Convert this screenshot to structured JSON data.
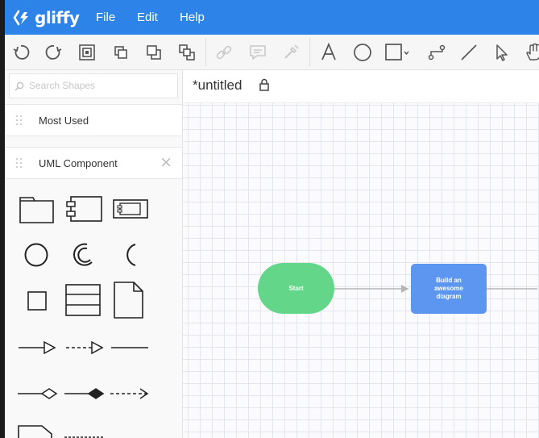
{
  "app": {
    "brand": "gliffy",
    "accent_color": "#2e83e8"
  },
  "menu": {
    "items": [
      "File",
      "Edit",
      "Help"
    ]
  },
  "toolbar": {
    "tools": [
      "undo-icon",
      "redo-icon",
      "bring-to-front-icon",
      "bring-forward-icon",
      "send-backward-icon",
      "send-to-back-icon",
      "link-icon",
      "comment-icon",
      "style-picker-icon",
      "text-tool-icon",
      "ellipse-tool-icon",
      "rectangle-tool-icon",
      "connector-tool-icon",
      "line-tool-icon",
      "pointer-tool-icon",
      "hand-tool-icon"
    ]
  },
  "sidebar": {
    "search": {
      "placeholder": "Search Shapes",
      "value": ""
    },
    "panels": [
      {
        "title": "Most Used"
      },
      {
        "title": "UML Component"
      }
    ],
    "uml_shapes": [
      "package-shape",
      "component-shape",
      "component-alt-shape",
      "interface-circle-shape",
      "required-interface-shape",
      "socket-shape",
      "port-shape",
      "class-shape",
      "artifact-shape",
      "dependency-connector",
      "dashed-dependency-connector",
      "association-connector",
      "aggregation-connector",
      "composition-connector",
      "dashed-open-arrow-connector"
    ]
  },
  "document": {
    "title": "*untitled"
  },
  "diagram": {
    "nodes": [
      {
        "id": "start",
        "label": "Start",
        "color": "#63d68a"
      },
      {
        "id": "build",
        "label": "Build an awesome diagram",
        "color": "#5d96f1"
      }
    ],
    "edge_color": "#b5b5b5"
  }
}
